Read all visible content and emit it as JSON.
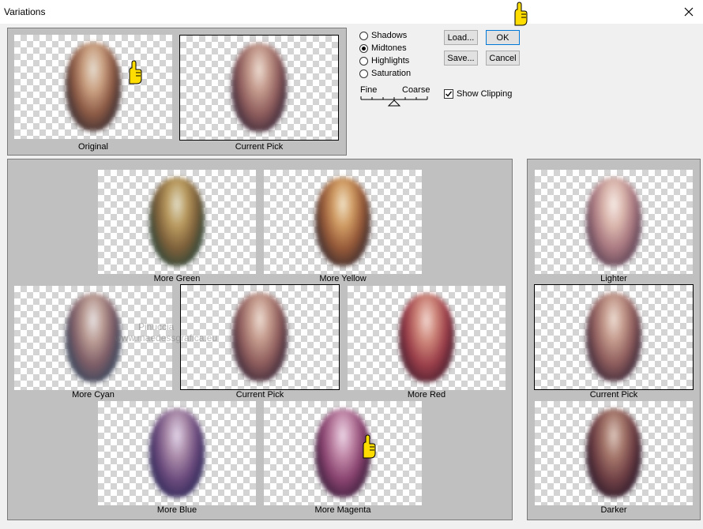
{
  "window": {
    "title": "Variations",
    "close_symbol": "✕"
  },
  "preview": {
    "original_label": "Original",
    "current_pick_label": "Current Pick"
  },
  "tone_options": [
    {
      "label": "Shadows",
      "selected": false
    },
    {
      "label": "Midtones",
      "selected": true
    },
    {
      "label": "Highlights",
      "selected": false
    },
    {
      "label": "Saturation",
      "selected": false
    }
  ],
  "slider": {
    "min_label": "Fine",
    "max_label": "Coarse",
    "position_fraction": 0.5,
    "tick_count": 7
  },
  "buttons": {
    "load": "Load...",
    "save": "Save...",
    "ok": "OK",
    "cancel": "Cancel"
  },
  "show_clipping": {
    "label": "Show Clipping",
    "checked": true
  },
  "color_variations": [
    {
      "label": "More Green",
      "tint": "green-yellow"
    },
    {
      "label": "More Yellow",
      "tint": "yellow-orange"
    },
    {
      "label": "More Cyan",
      "tint": "cyan-blue"
    },
    {
      "label": "Current Pick",
      "tint": "neutral"
    },
    {
      "label": "More Red",
      "tint": "red"
    },
    {
      "label": "More Blue",
      "tint": "blue-purple"
    },
    {
      "label": "More Magenta",
      "tint": "magenta"
    }
  ],
  "brightness_variations": [
    {
      "label": "Lighter"
    },
    {
      "label": "Current Pick"
    },
    {
      "label": "Darker"
    }
  ],
  "watermark": {
    "line1": "Pinuccia",
    "line2": "www.maedessgrafica.eu"
  },
  "colors": {
    "panel_bg": "#c0c0c0",
    "default_button_border": "#0078d7",
    "pointer_hand": "#ffdd00"
  }
}
